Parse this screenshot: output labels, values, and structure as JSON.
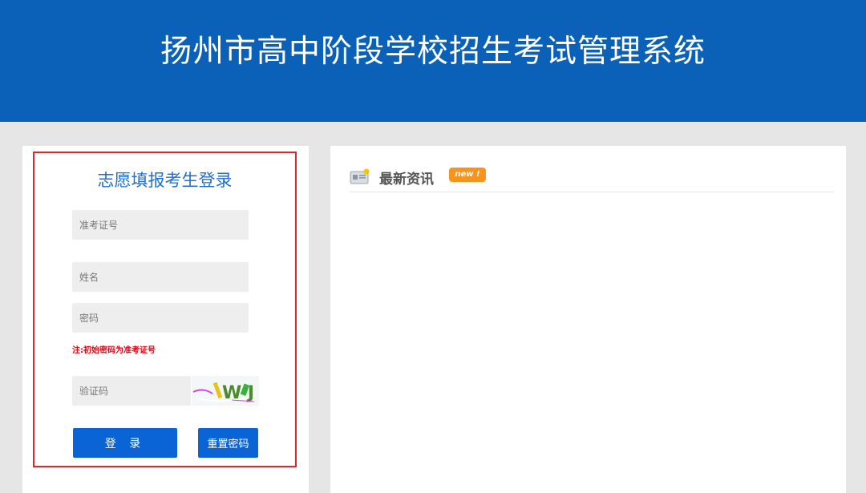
{
  "header": {
    "title": "扬州市高中阶段学校招生考试管理系统"
  },
  "login": {
    "title": "志愿填报考生登录",
    "exam_id_placeholder": "准考证号",
    "name_placeholder": "姓名",
    "password_placeholder": "密码",
    "password_note": "注:初始密码为准考证号",
    "captcha_placeholder": "验证码",
    "captcha_text": "W J",
    "login_button": "登 录",
    "reset_button": "重置密码"
  },
  "news": {
    "title": "最新资讯",
    "badge": "new !"
  },
  "colors": {
    "header_bg": "#0b61b7",
    "login_title": "#1f6fcf",
    "button_bg": "#0a64d6",
    "note": "#e60012",
    "highlight_border": "#e0262b",
    "badge_bg": "#f7941d"
  }
}
